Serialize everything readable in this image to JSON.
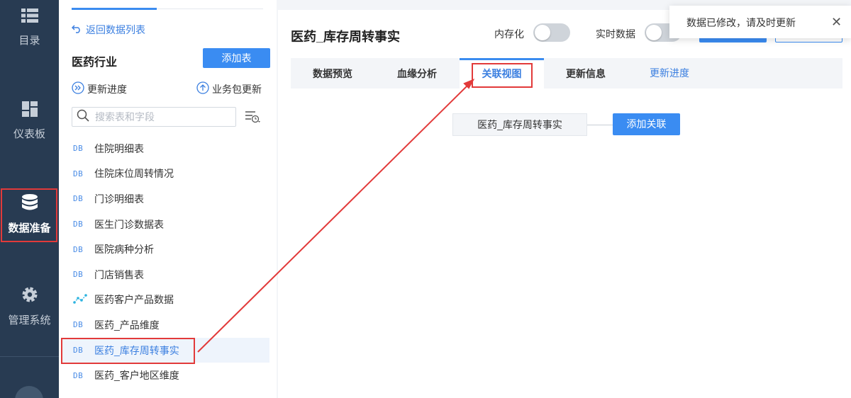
{
  "nav": {
    "items": [
      {
        "label": "目录",
        "icon": "list-icon"
      },
      {
        "label": "仪表板",
        "icon": "dashboard-icon"
      },
      {
        "label": "数据准备",
        "icon": "database-icon"
      },
      {
        "label": "管理系统",
        "icon": "gear-icon"
      }
    ],
    "active_index": 2
  },
  "sidebar": {
    "back_label": "返回数据列表",
    "industry": "医药行业",
    "add_table_label": "添加表",
    "progress_label": "更新进度",
    "bizpkg_label": "业务包更新",
    "search_placeholder": "搜索表和字段",
    "tables": [
      {
        "tag": "DB",
        "name": "住院明细表"
      },
      {
        "tag": "DB",
        "name": "住院床位周转情况"
      },
      {
        "tag": "DB",
        "name": "门诊明细表"
      },
      {
        "tag": "DB",
        "name": "医生门诊数据表"
      },
      {
        "tag": "DB",
        "name": "医院病种分析"
      },
      {
        "tag": "DB",
        "name": "门店销售表"
      },
      {
        "tag": "etl",
        "name": "医药客户产品数据"
      },
      {
        "tag": "DB",
        "name": "医药_产品维度"
      },
      {
        "tag": "DB",
        "name": "医药_库存周转事实"
      },
      {
        "tag": "DB",
        "name": "医药_客户地区维度"
      }
    ],
    "selected_index": 8
  },
  "header": {
    "title": "医药_库存周转事实",
    "in_memory_label": "内存化",
    "realtime_label": "实时数据"
  },
  "tabs": {
    "preview": "数据预览",
    "lineage": "血缘分析",
    "relation": "关联视图",
    "update_info": "更新信息",
    "update_progress": "更新进度"
  },
  "relation": {
    "node_label": "医药_库存周转事实",
    "add_button": "添加关联"
  },
  "toast": {
    "message": "数据已修改，请及时更新"
  },
  "colors": {
    "accent": "#3a8cf2",
    "nav_bg": "#283b52",
    "highlight": "#e23a3a"
  }
}
